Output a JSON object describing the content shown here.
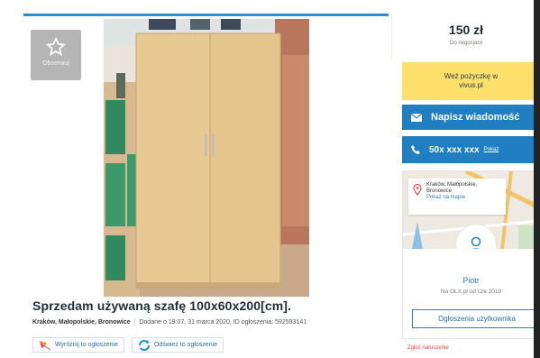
{
  "listing": {
    "favorite_label": "Obserwuj",
    "title": "Sprzedam używaną szafę 100x60x200[cm].",
    "location": "Kraków, Małopolskie, Bronowice",
    "added": "Dodane o 19:07, 31 marca 2020, ID ogłoszenia: 592593141",
    "promote_label": "Wyróżnij to ogłoszenie",
    "refresh_label": "Odśwież to ogłoszenie"
  },
  "sidebar": {
    "price": "150 zł",
    "negotiable": "Do negocjacji",
    "loan_line1": "Weź pożyczkę w",
    "loan_line2": "vivus.pl",
    "message_label": "Napisz wiadomość",
    "phone_label": "50x xxx xxx",
    "phone_show": "Pokaż",
    "map_location_line1": "Kraków, Małopolskie,",
    "map_location_line2": "Bronowice",
    "map_link": "Pokaż na mapie",
    "user_name": "Piotr",
    "member_since": "Na OLX.pl od cze 2019",
    "user_ads_label": "Ogłoszenia użytkownika",
    "report_label": "Zgłoś naruszenie"
  },
  "colors": {
    "accent_blue": "#1f7fc1",
    "loan_yellow": "#fde06b",
    "report_red": "#e0443c"
  }
}
